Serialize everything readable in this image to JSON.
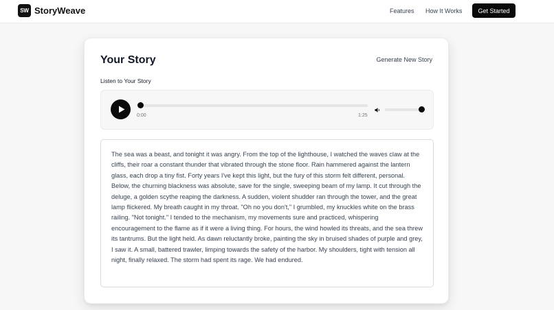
{
  "header": {
    "logo_text": "SW",
    "brand": "StoryWeave",
    "nav": [
      "Features",
      "How It Works"
    ],
    "cta_label": "Get Started"
  },
  "card": {
    "title": "Your Story",
    "generate_label": "Generate New Story",
    "listen_label": "Listen to Your Story"
  },
  "player": {
    "current_time": "0:00",
    "duration": "1:25",
    "progress": 0,
    "volume": 1
  },
  "story": {
    "text": "The sea was a beast, and tonight it was angry. From the top of the lighthouse, I watched the waves claw at the cliffs, their roar a constant thunder that vibrated through the stone floor. Rain hammered against the lantern glass, each drop a tiny fist. Forty years I've kept this light, but the fury of this storm felt different, personal. Below, the churning blackness was absolute, save for the single, sweeping beam of my lamp. It cut through the deluge, a golden scythe reaping the darkness. A sudden, violent shudder ran through the tower, and the great lamp flickered. My breath caught in my throat. \"Oh no you don't,\" I grumbled, my knuckles white on the brass railing. \"Not tonight.\" I tended to the mechanism, my movements sure and practiced, whispering encouragement to the flame as if it were a living thing. For hours, the wind howled its threats, and the sea threw its tantrums. But the light held. As dawn reluctantly broke, painting the sky in bruised shades of purple and grey, I saw it. A small, battered trawler, limping towards the safety of the harbor. My shoulders, tight with tension all night, finally relaxed. The storm had spent its rage. We had endured."
  },
  "icons": {
    "play": "play-icon",
    "volume": "volume-icon"
  },
  "colors": {
    "accent": "#0a0a0a",
    "background": "#f7f7f8",
    "card": "#ffffff"
  }
}
